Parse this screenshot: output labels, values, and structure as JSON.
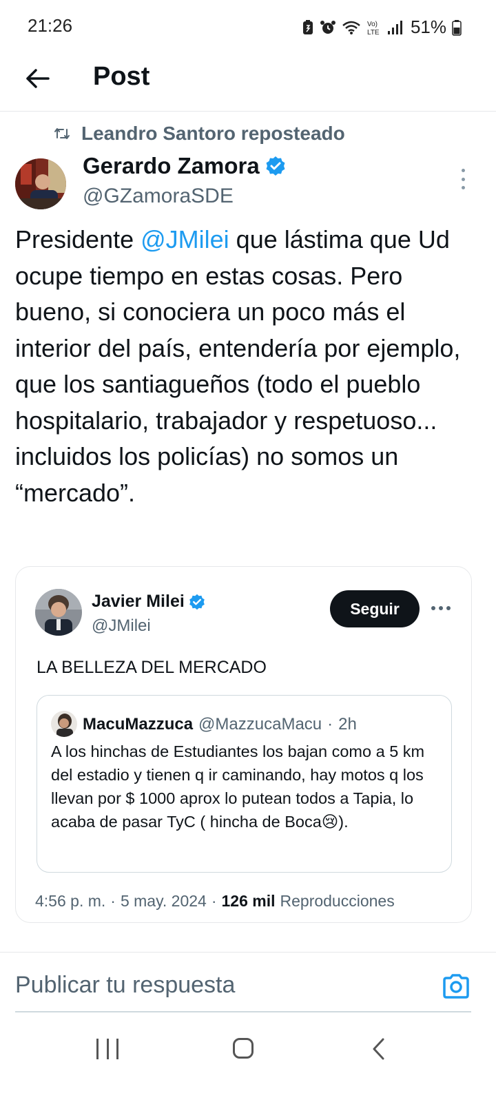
{
  "status": {
    "time": "21:26",
    "battery": "51%",
    "network": "LTE"
  },
  "header": {
    "title": "Post"
  },
  "repost": {
    "text": "Leandro Santoro reposteado"
  },
  "author": {
    "name": "Gerardo Zamora",
    "handle": "@GZamoraSDE",
    "verified": true
  },
  "tweet": {
    "part1": "Presidente ",
    "mention": "@JMilei",
    "part2": " que lástima  que Ud ocupe tiempo en estas cosas. Pero bueno, si conociera  un poco más el interior del país, entendería por ejemplo,  que los santiagueños (todo el pueblo hospitalario, trabajador y respetuoso... incluidos los policías) no somos un “mercado”."
  },
  "embedded": {
    "name": "Javier Milei",
    "handle": "@JMilei",
    "follow_label": "Seguir",
    "text": "LA BELLEZA DEL MERCADO",
    "quoted": {
      "name": "MacuMazzuca",
      "handle": "@MazzucaMacu",
      "separator": "·",
      "time": "2h",
      "text": "A los hinchas de Estudiantes los bajan como a 5 km del estadio y tienen q ir caminando, hay motos q los llevan por $ 1000 aprox lo putean todos a Tapia, lo acaba de pasar TyC ( hincha de Boca😢)."
    },
    "footer": {
      "time": "4:56 p. m.",
      "sep1": "·",
      "date": "5 may. 2024",
      "sep2": "·",
      "views_count": "126 mil",
      "views_label": "Reproducciones"
    }
  },
  "reply": {
    "placeholder": "Publicar tu respuesta"
  },
  "colors": {
    "accent": "#1d9bf0",
    "text": "#0f1419",
    "secondary": "#536471"
  },
  "icons": [
    "back-arrow-icon",
    "repost-icon",
    "verified-badge-icon",
    "more-vertical-icon",
    "more-horizontal-icon",
    "camera-icon",
    "nav-recents-icon",
    "nav-home-icon",
    "nav-back-icon"
  ]
}
